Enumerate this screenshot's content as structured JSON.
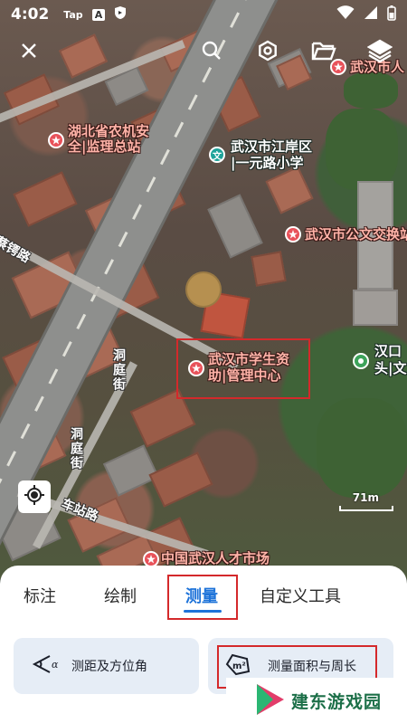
{
  "status_bar": {
    "time": "4:02",
    "app1": "Tap",
    "app2": "A"
  },
  "map": {
    "pois": [
      {
        "id": "poi-wuhan-top",
        "text": "武汉市人"
      },
      {
        "id": "poi-hubei-1",
        "text": "湖北省农机安"
      },
      {
        "id": "poi-hubei-2",
        "text": "全|监理总站"
      },
      {
        "id": "poi-jiangan-1",
        "text": "武汉市江岸区"
      },
      {
        "id": "poi-jiangan-2",
        "text": "|一元路小学"
      },
      {
        "id": "poi-gongwen",
        "text": "武汉市公文交换站"
      },
      {
        "id": "poi-xuesheng-1",
        "text": "武汉市学生资"
      },
      {
        "id": "poi-xuesheng-2",
        "text": "助|管理中心"
      },
      {
        "id": "poi-hankou-1",
        "text": "汉口"
      },
      {
        "id": "poi-hankou-2",
        "text": "头|文"
      },
      {
        "id": "poi-rencai",
        "text": "中国武汉人才市场"
      }
    ],
    "roads": {
      "caie": "蔡锷路",
      "dongting1": "洞庭街",
      "dongting2": "洞庭街",
      "chezhan": "车站路"
    },
    "poi_badge": "文",
    "scale_label": "71m"
  },
  "toolbar": {
    "icons": [
      "close-icon",
      "search-icon",
      "settings-icon",
      "folder-icon",
      "layers-icon"
    ]
  },
  "tabs": [
    {
      "label": "标注"
    },
    {
      "label": "绘制"
    },
    {
      "label": "测量",
      "active": true
    },
    {
      "label": "自定义工具"
    }
  ],
  "tools": [
    {
      "label": "测距及方位角"
    },
    {
      "label": "测量面积与周长"
    }
  ],
  "watermark": {
    "text": "建东游戏园"
  },
  "colors": {
    "accent": "#1e73d9",
    "highlight_red": "#d4292b",
    "card_bg": "#e6edf6",
    "poi_text": "#ffb3a8"
  }
}
